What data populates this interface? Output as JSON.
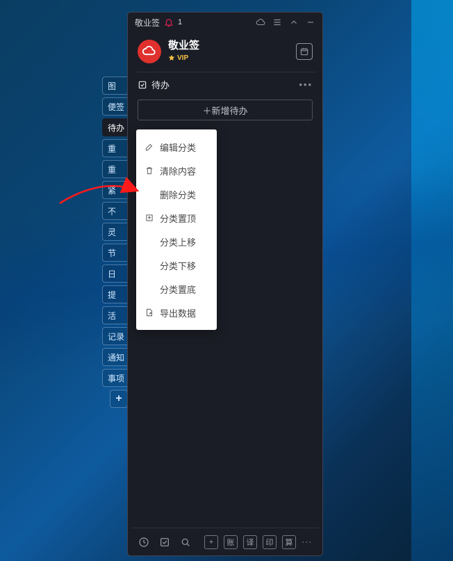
{
  "titlebar": {
    "app_name": "敬业签",
    "notif_count": "1"
  },
  "header": {
    "title": "敬业签",
    "vip_label": "VIP"
  },
  "section": {
    "title": "待办",
    "more": "•••"
  },
  "new_button": {
    "label": "＋新增待办"
  },
  "side_tabs": [
    "图",
    "便签",
    "待办",
    "重",
    "重",
    "紧",
    "不",
    "灵",
    "节",
    "日",
    "提",
    "活",
    "记录",
    "通知",
    "事项"
  ],
  "context_menu": {
    "items": [
      {
        "label": "编辑分类",
        "icon": "edit"
      },
      {
        "label": "清除内容",
        "icon": "trash"
      },
      {
        "label": "删除分类",
        "icon": ""
      },
      {
        "label": "分类置顶",
        "icon": "top"
      },
      {
        "label": "分类上移",
        "icon": ""
      },
      {
        "label": "分类下移",
        "icon": ""
      },
      {
        "label": "分类置底",
        "icon": ""
      },
      {
        "label": "导出数据",
        "icon": "export"
      }
    ]
  },
  "bottom_bar": {
    "right_labels": [
      "账",
      "译",
      "印",
      "算"
    ]
  },
  "colors": {
    "accent_red": "#e0312e",
    "vip_gold": "#f5c242",
    "panel_bg": "#1b1d26"
  }
}
